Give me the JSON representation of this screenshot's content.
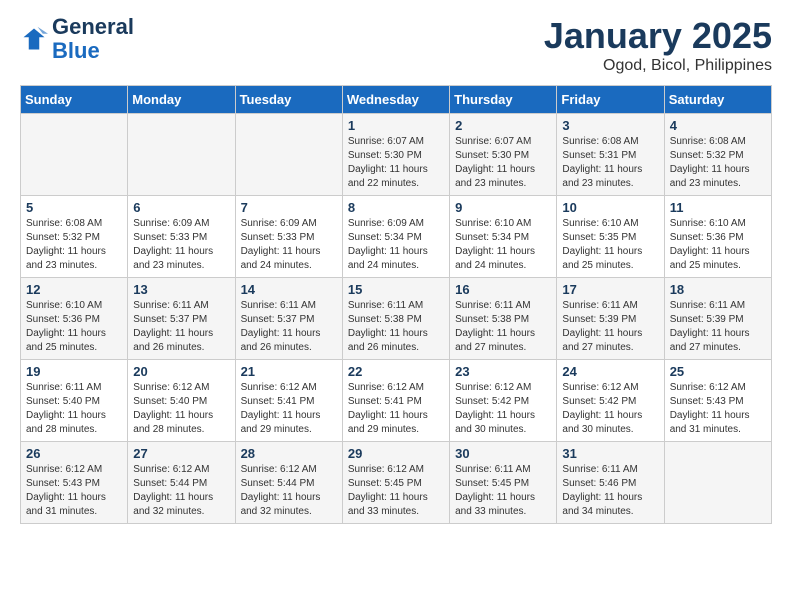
{
  "header": {
    "logo_line1": "General",
    "logo_line2": "Blue",
    "title": "January 2025",
    "subtitle": "Ogod, Bicol, Philippines"
  },
  "weekdays": [
    "Sunday",
    "Monday",
    "Tuesday",
    "Wednesday",
    "Thursday",
    "Friday",
    "Saturday"
  ],
  "weeks": [
    [
      {
        "day": "",
        "text": ""
      },
      {
        "day": "",
        "text": ""
      },
      {
        "day": "",
        "text": ""
      },
      {
        "day": "1",
        "text": "Sunrise: 6:07 AM\nSunset: 5:30 PM\nDaylight: 11 hours\nand 22 minutes."
      },
      {
        "day": "2",
        "text": "Sunrise: 6:07 AM\nSunset: 5:30 PM\nDaylight: 11 hours\nand 23 minutes."
      },
      {
        "day": "3",
        "text": "Sunrise: 6:08 AM\nSunset: 5:31 PM\nDaylight: 11 hours\nand 23 minutes."
      },
      {
        "day": "4",
        "text": "Sunrise: 6:08 AM\nSunset: 5:32 PM\nDaylight: 11 hours\nand 23 minutes."
      }
    ],
    [
      {
        "day": "5",
        "text": "Sunrise: 6:08 AM\nSunset: 5:32 PM\nDaylight: 11 hours\nand 23 minutes."
      },
      {
        "day": "6",
        "text": "Sunrise: 6:09 AM\nSunset: 5:33 PM\nDaylight: 11 hours\nand 23 minutes."
      },
      {
        "day": "7",
        "text": "Sunrise: 6:09 AM\nSunset: 5:33 PM\nDaylight: 11 hours\nand 24 minutes."
      },
      {
        "day": "8",
        "text": "Sunrise: 6:09 AM\nSunset: 5:34 PM\nDaylight: 11 hours\nand 24 minutes."
      },
      {
        "day": "9",
        "text": "Sunrise: 6:10 AM\nSunset: 5:34 PM\nDaylight: 11 hours\nand 24 minutes."
      },
      {
        "day": "10",
        "text": "Sunrise: 6:10 AM\nSunset: 5:35 PM\nDaylight: 11 hours\nand 25 minutes."
      },
      {
        "day": "11",
        "text": "Sunrise: 6:10 AM\nSunset: 5:36 PM\nDaylight: 11 hours\nand 25 minutes."
      }
    ],
    [
      {
        "day": "12",
        "text": "Sunrise: 6:10 AM\nSunset: 5:36 PM\nDaylight: 11 hours\nand 25 minutes."
      },
      {
        "day": "13",
        "text": "Sunrise: 6:11 AM\nSunset: 5:37 PM\nDaylight: 11 hours\nand 26 minutes."
      },
      {
        "day": "14",
        "text": "Sunrise: 6:11 AM\nSunset: 5:37 PM\nDaylight: 11 hours\nand 26 minutes."
      },
      {
        "day": "15",
        "text": "Sunrise: 6:11 AM\nSunset: 5:38 PM\nDaylight: 11 hours\nand 26 minutes."
      },
      {
        "day": "16",
        "text": "Sunrise: 6:11 AM\nSunset: 5:38 PM\nDaylight: 11 hours\nand 27 minutes."
      },
      {
        "day": "17",
        "text": "Sunrise: 6:11 AM\nSunset: 5:39 PM\nDaylight: 11 hours\nand 27 minutes."
      },
      {
        "day": "18",
        "text": "Sunrise: 6:11 AM\nSunset: 5:39 PM\nDaylight: 11 hours\nand 27 minutes."
      }
    ],
    [
      {
        "day": "19",
        "text": "Sunrise: 6:11 AM\nSunset: 5:40 PM\nDaylight: 11 hours\nand 28 minutes."
      },
      {
        "day": "20",
        "text": "Sunrise: 6:12 AM\nSunset: 5:40 PM\nDaylight: 11 hours\nand 28 minutes."
      },
      {
        "day": "21",
        "text": "Sunrise: 6:12 AM\nSunset: 5:41 PM\nDaylight: 11 hours\nand 29 minutes."
      },
      {
        "day": "22",
        "text": "Sunrise: 6:12 AM\nSunset: 5:41 PM\nDaylight: 11 hours\nand 29 minutes."
      },
      {
        "day": "23",
        "text": "Sunrise: 6:12 AM\nSunset: 5:42 PM\nDaylight: 11 hours\nand 30 minutes."
      },
      {
        "day": "24",
        "text": "Sunrise: 6:12 AM\nSunset: 5:42 PM\nDaylight: 11 hours\nand 30 minutes."
      },
      {
        "day": "25",
        "text": "Sunrise: 6:12 AM\nSunset: 5:43 PM\nDaylight: 11 hours\nand 31 minutes."
      }
    ],
    [
      {
        "day": "26",
        "text": "Sunrise: 6:12 AM\nSunset: 5:43 PM\nDaylight: 11 hours\nand 31 minutes."
      },
      {
        "day": "27",
        "text": "Sunrise: 6:12 AM\nSunset: 5:44 PM\nDaylight: 11 hours\nand 32 minutes."
      },
      {
        "day": "28",
        "text": "Sunrise: 6:12 AM\nSunset: 5:44 PM\nDaylight: 11 hours\nand 32 minutes."
      },
      {
        "day": "29",
        "text": "Sunrise: 6:12 AM\nSunset: 5:45 PM\nDaylight: 11 hours\nand 33 minutes."
      },
      {
        "day": "30",
        "text": "Sunrise: 6:11 AM\nSunset: 5:45 PM\nDaylight: 11 hours\nand 33 minutes."
      },
      {
        "day": "31",
        "text": "Sunrise: 6:11 AM\nSunset: 5:46 PM\nDaylight: 11 hours\nand 34 minutes."
      },
      {
        "day": "",
        "text": ""
      }
    ]
  ]
}
